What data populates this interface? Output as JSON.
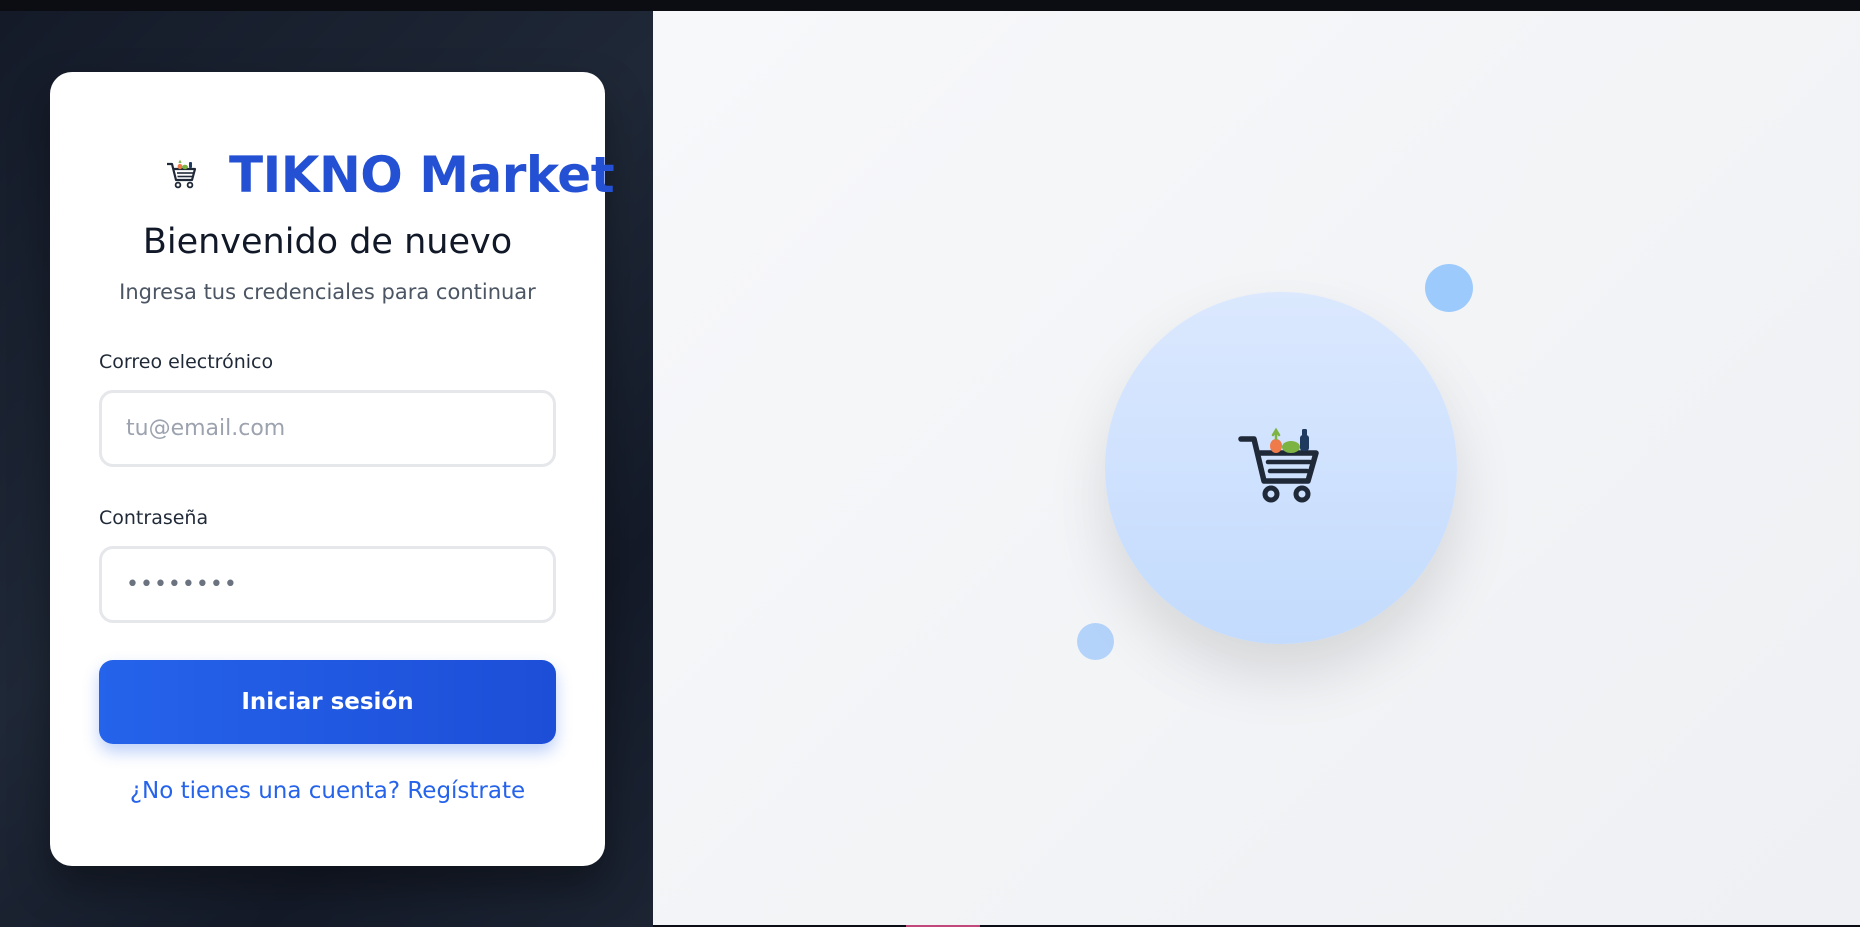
{
  "brand": {
    "name": "TIKNO Market",
    "logo_icon": "shopping-cart-icon"
  },
  "login": {
    "title": "Bienvenido de nuevo",
    "subtitle": "Ingresa tus credenciales para continuar",
    "email_label": "Correo electrónico",
    "email_placeholder": "tu@email.com",
    "password_label": "Contraseña",
    "password_value": "••••••••",
    "submit_label": "Iniciar sesión",
    "register_link": "¿No tienes una cuenta? Regístrate"
  },
  "hero": {
    "icon": "grocery-cart-icon"
  },
  "colors": {
    "brand_blue": "#2451d3",
    "button_blue": "#2563eb",
    "dark_panel": "#1f2837",
    "hero_circle": "#c3dbfd"
  }
}
